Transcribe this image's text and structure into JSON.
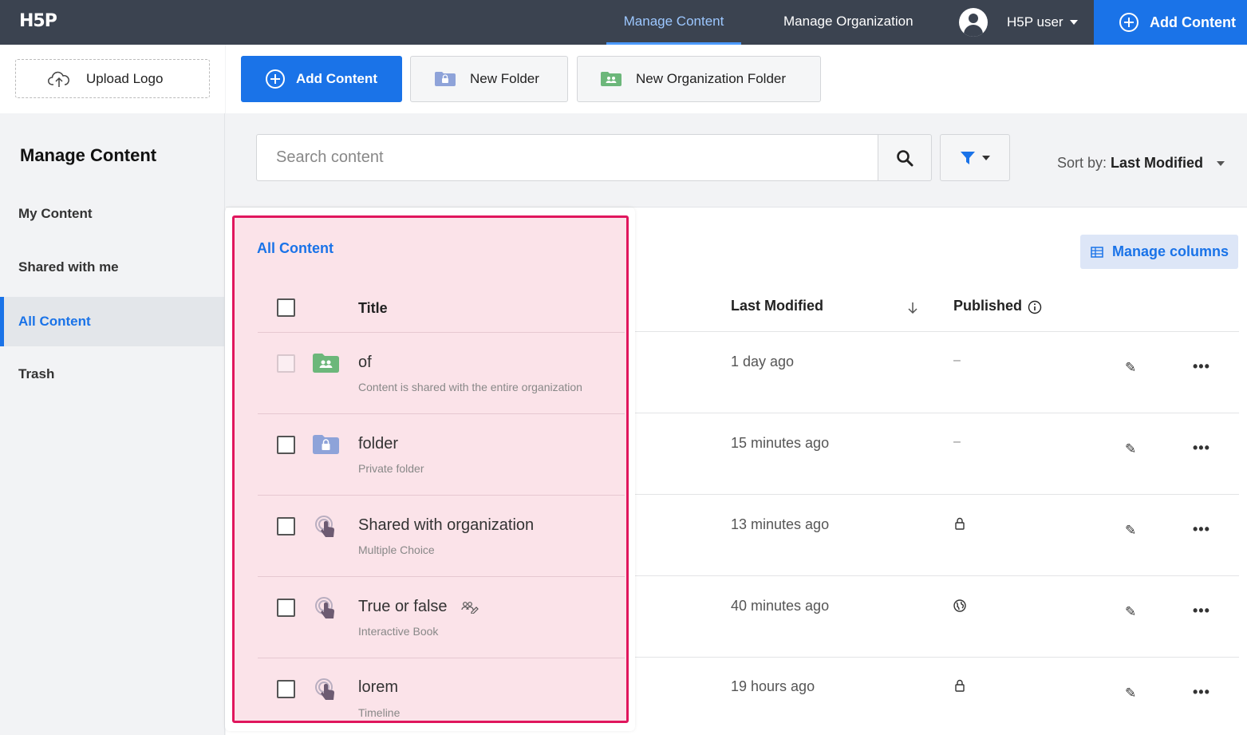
{
  "app": {
    "logo": "H5P"
  },
  "topbar": {
    "nav": [
      "Manage Content",
      "Manage Organization"
    ],
    "user": "H5P user",
    "add_content": "Add Content"
  },
  "lefttop": {
    "upload_logo": "Upload Logo"
  },
  "toolbar": {
    "add_content": "Add Content",
    "new_folder": "New Folder",
    "new_org_folder": "New Organization Folder"
  },
  "sidebar": {
    "title": "Manage Content",
    "items": [
      "My Content",
      "Shared with me",
      "All Content",
      "Trash"
    ],
    "active": "All Content"
  },
  "search": {
    "placeholder": "Search content"
  },
  "sort": {
    "label": "Sort by:",
    "value": "Last Modified"
  },
  "manage_columns": "Manage columns",
  "table": {
    "section_title": "All Content",
    "headers": {
      "title": "Title",
      "last_modified": "Last Modified",
      "published": "Published"
    },
    "rows": [
      {
        "title": "of",
        "subtitle": "Content is shared with the entire organization",
        "type": "org-folder",
        "modified": "1 day ago",
        "published": "–"
      },
      {
        "title": "folder",
        "subtitle": "Private folder",
        "type": "private-folder",
        "modified": "15 minutes ago",
        "published": "–"
      },
      {
        "title": "Shared with organization",
        "subtitle": "Multiple Choice",
        "type": "content",
        "modified": "13 minutes ago",
        "published": "lock"
      },
      {
        "title": "True or false",
        "subtitle": "Interactive Book",
        "type": "content",
        "modified": "40 minutes ago",
        "published": "globe"
      },
      {
        "title": "lorem",
        "subtitle": "Timeline",
        "type": "content",
        "modified": "19 hours ago",
        "published": "lock"
      }
    ]
  },
  "colors": {
    "topbar": "#3b4350",
    "primary": "#1a73e8",
    "highlight_border": "#e0165d",
    "highlight_fill": "#fbe3e9",
    "org_folder": "#6cb77a",
    "private_folder": "#8ea3d9"
  }
}
